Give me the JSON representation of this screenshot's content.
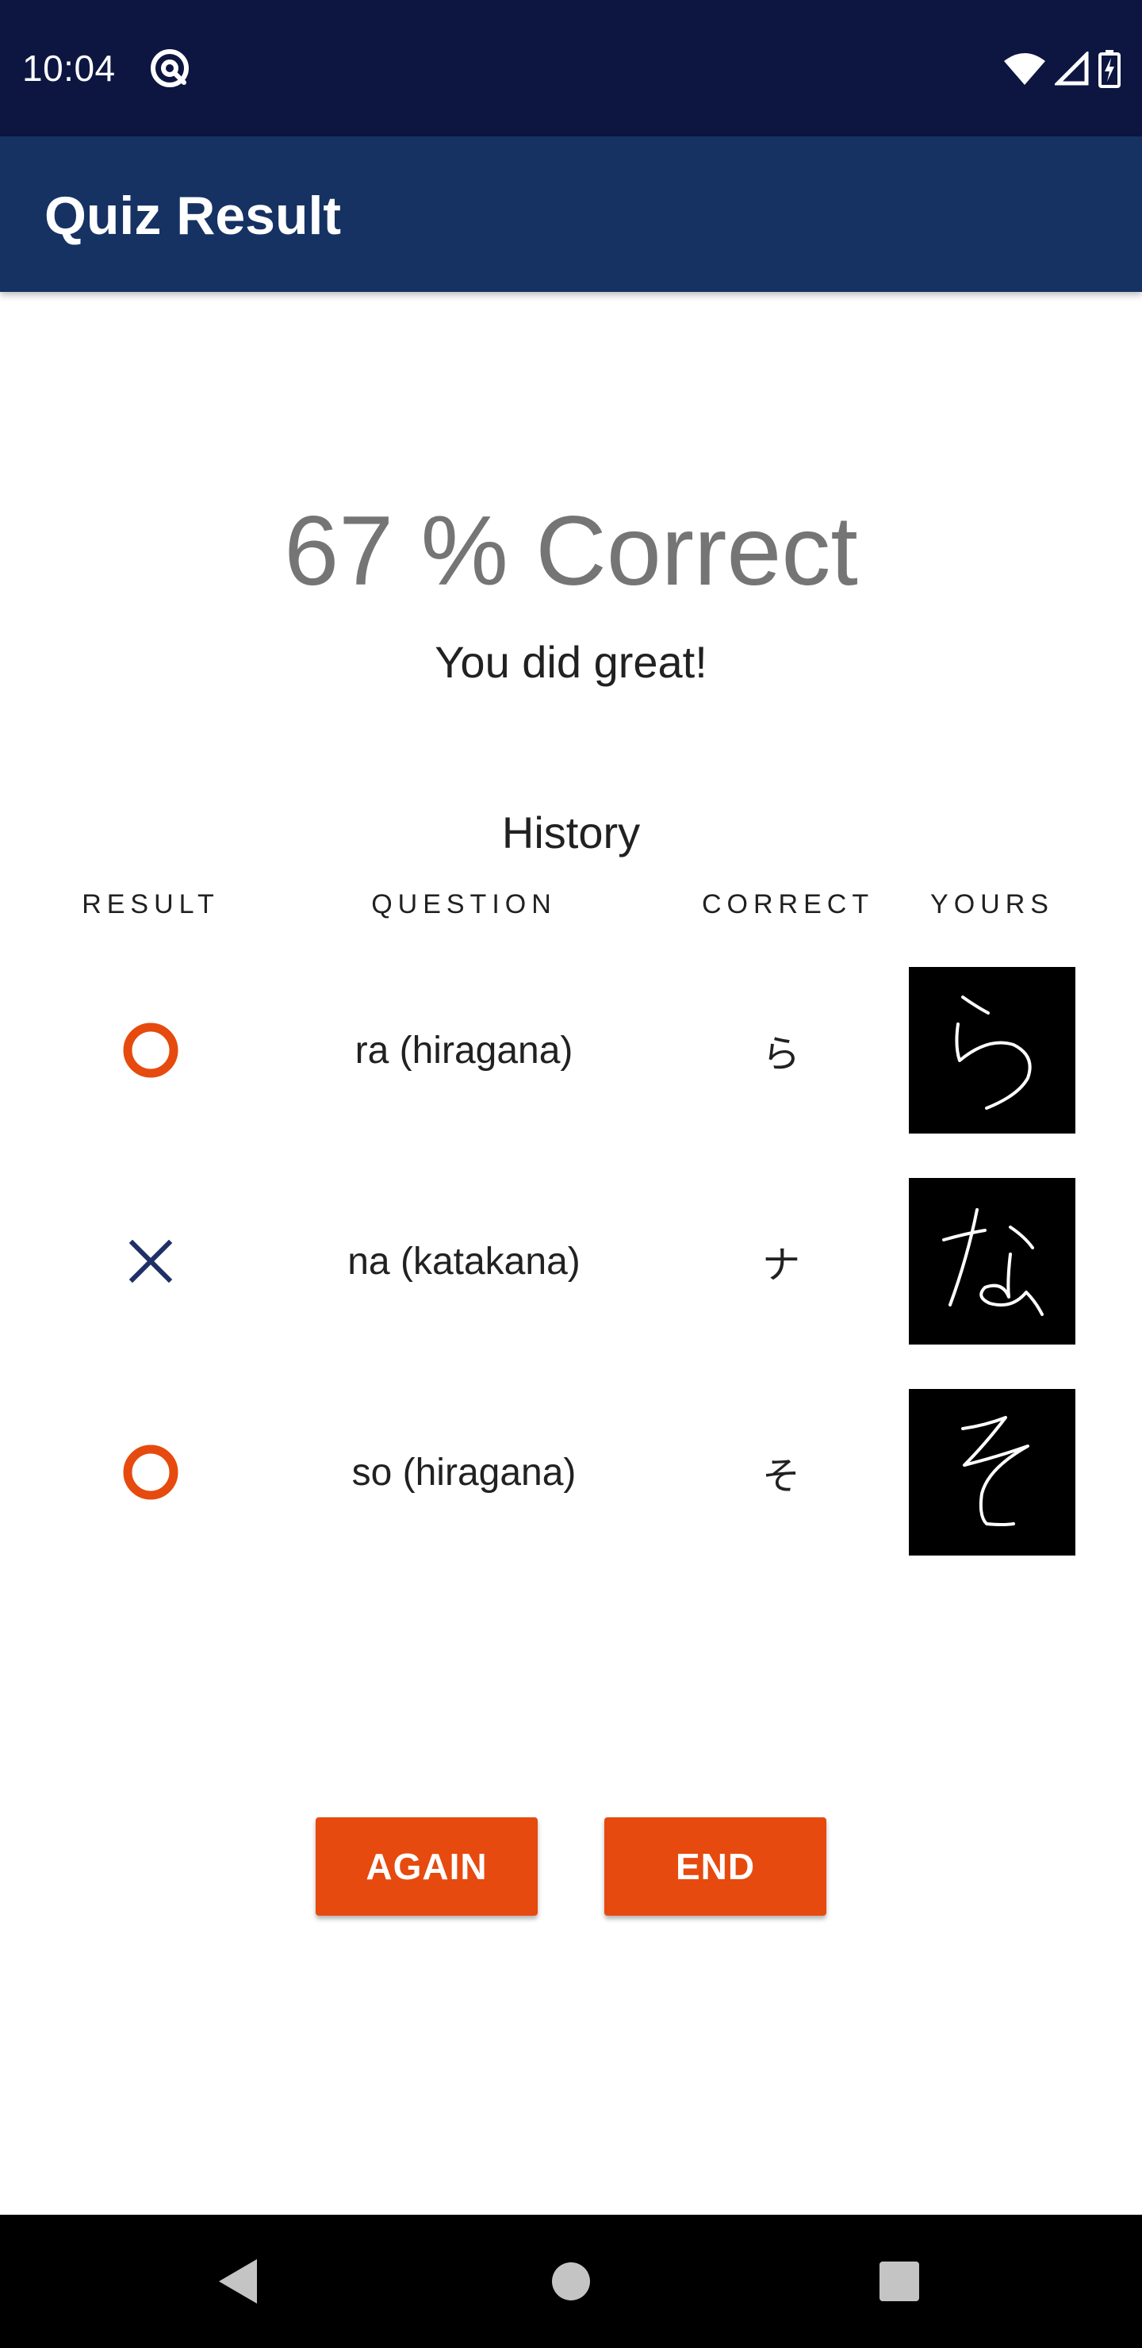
{
  "status_bar": {
    "time": "10:04",
    "app_icon": "at-sign-icon",
    "icons": [
      "wifi-icon",
      "cell-signal-icon",
      "battery-charging-icon"
    ]
  },
  "app_bar": {
    "title": "Quiz Result"
  },
  "result": {
    "score_text": "67 % Correct",
    "message": "You did great!"
  },
  "history": {
    "title": "History",
    "columns": {
      "result": "RESULT",
      "question": "QUESTION",
      "correct": "CORRECT",
      "yours": "YOURS"
    },
    "rows": [
      {
        "result": "correct",
        "result_icon": "circle-icon",
        "question": "ra (hiragana)",
        "correct": "ら",
        "yours_icon": "handwritten-ra-icon"
      },
      {
        "result": "incorrect",
        "result_icon": "cross-icon",
        "question": "na (katakana)",
        "correct": "ナ",
        "yours_icon": "handwritten-na-icon"
      },
      {
        "result": "correct",
        "result_icon": "circle-icon",
        "question": "so (hiragana)",
        "correct": "そ",
        "yours_icon": "handwritten-so-icon"
      }
    ]
  },
  "buttons": {
    "again": "AGAIN",
    "end": "END"
  },
  "colors": {
    "status_bar": "#0d1641",
    "app_bar": "#163263",
    "accent": "#e64a0e",
    "cross": "#1f3066",
    "score_text": "#757575"
  },
  "nav_bar": {
    "icons": [
      "back-icon",
      "home-icon",
      "recents-icon"
    ]
  }
}
